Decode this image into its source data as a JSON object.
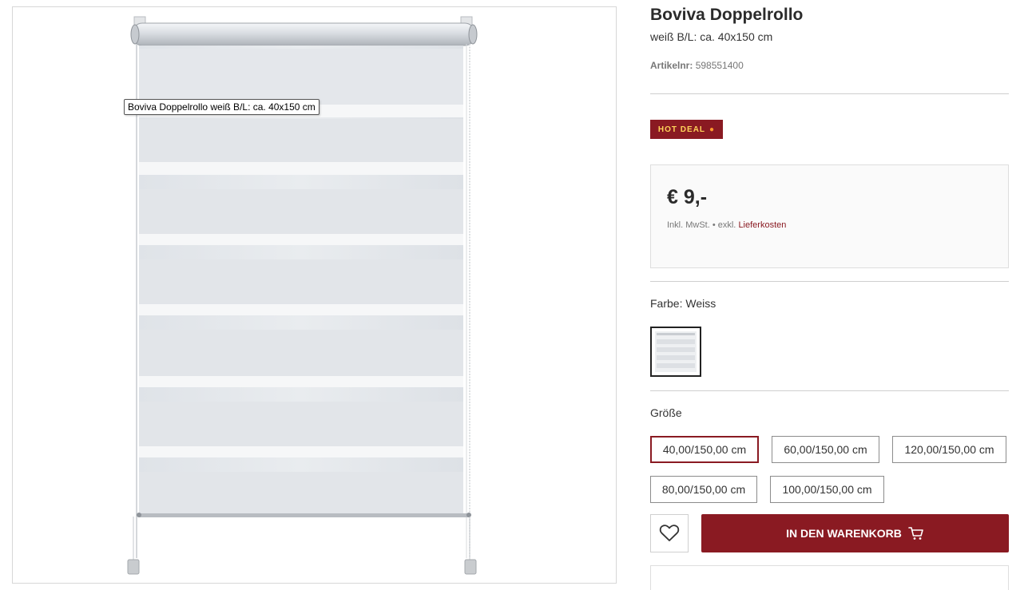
{
  "product": {
    "title": "Boviva Doppelrollo",
    "subtitle": "weiß B/L: ca. 40x150 cm",
    "article_label": "Artikelnr:",
    "article_number": "598551400",
    "badge": "HOT DEAL",
    "badge_icon": "flame-icon",
    "price": "€ 9,-",
    "vat_text": "Inkl. MwSt. • exkl.",
    "shipping_link": "Lieferkosten",
    "image_tooltip": "Boviva Doppelrollo weiß B/L: ca. 40x150 cm"
  },
  "color": {
    "label": "Farbe: Weiss",
    "selected": "Weiss"
  },
  "size": {
    "label": "Größe",
    "options": [
      "40,00/150,00 cm",
      "60,00/150,00 cm",
      "120,00/150,00 cm",
      "80,00/150,00 cm",
      "100,00/150,00 cm"
    ],
    "selected": "40,00/150,00 cm"
  },
  "actions": {
    "wishlist_icon": "heart-icon",
    "cart_label": "IN DEN WARENKORB",
    "cart_icon": "cart-icon"
  },
  "colors": {
    "brand": "#8a1a22",
    "badge_text": "#ffd35a"
  }
}
